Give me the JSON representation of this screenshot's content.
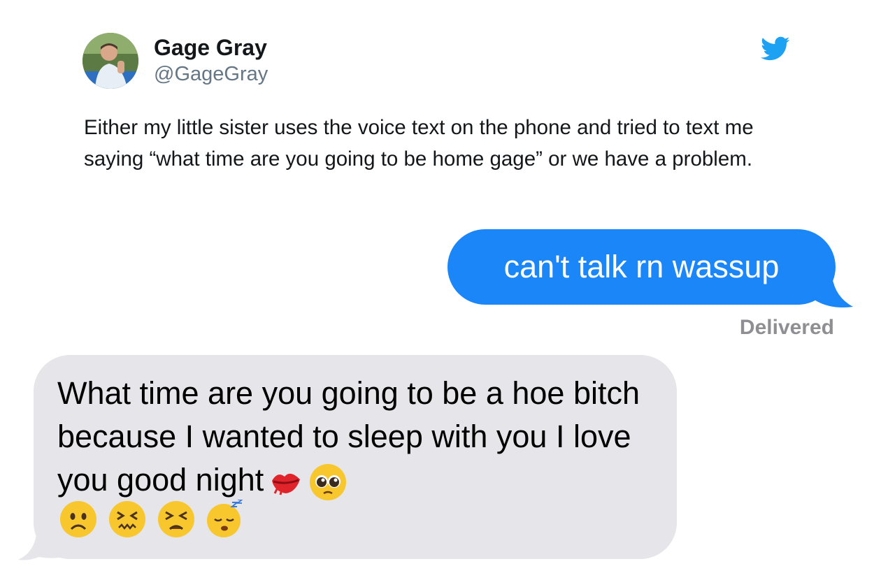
{
  "tweet": {
    "author_name": "Gage Gray",
    "author_handle": "@GageGray",
    "avatar_icon": "profile-photo",
    "platform_icon": "twitter-bird-icon",
    "brand_color": "#1da1f2",
    "text": "Either my little sister uses the voice text on the phone and tried to text me saying “what time are you going to be home gage” or we have a problem."
  },
  "messages": {
    "sent": {
      "text": "can't talk rn wassup",
      "status": "Delivered",
      "bubble_color": "#1b86f8"
    },
    "received": {
      "text": "What time are you going to be a hoe bitch because I wanted to sleep with you I love you good night",
      "bubble_color": "#e5e5ea",
      "inline_emojis": [
        "kiss-mark-emoji",
        "pleading-face-emoji"
      ],
      "trailing_emojis": [
        "frowning-face-emoji",
        "confounded-face-emoji",
        "persevering-face-emoji",
        "sleeping-face-emoji"
      ]
    }
  }
}
